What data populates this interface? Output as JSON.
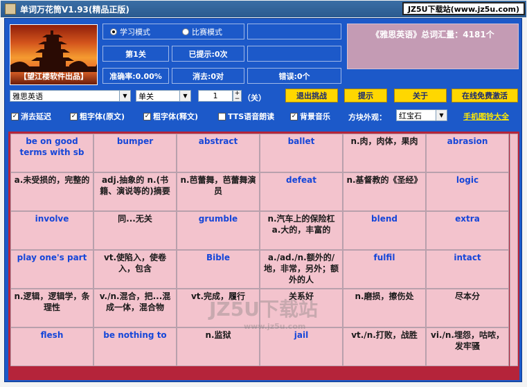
{
  "window": {
    "title": "单词万花筒V1.93(精品正版)",
    "badge": "JZ5U下载站(www.jz5u.com)"
  },
  "logo": {
    "caption": "【望江楼软件出品】"
  },
  "modes": {
    "study": "学习模式",
    "compete": "比赛模式",
    "selected": "study"
  },
  "stats": {
    "level": "第1关",
    "hints": "已提示:0次",
    "accuracy": "准确率:0.00%",
    "eliminated": "消去:0对",
    "errors": "错误:0个"
  },
  "vocab": {
    "text": "《雅思英语》总词汇量：4181个"
  },
  "controls": {
    "book": "雅思英语",
    "mode": "单关",
    "level_value": "1",
    "level_suffix": "（关）",
    "exit_button": "退出挑战",
    "hint_button": "提示",
    "about_button": "关于",
    "activate_button": "在线免费激活",
    "spin_up": "+",
    "spin_down": "−"
  },
  "options": {
    "delay": "消去延迟",
    "bold_orig": "粗字体(原文)",
    "bold_trans": "粗字体(释文)",
    "tts": "TTS语音朗读",
    "bgm": "背景音乐",
    "skin_label": "方块外观：",
    "skin_value": "红宝石",
    "ringtone_link": "手机图铃大全",
    "check_mark": "✓"
  },
  "grid": [
    [
      "be on good terms with sb",
      "bumper",
      "abstract",
      "ballet",
      "n.肉，肉体，果肉",
      "abrasion"
    ],
    [
      "a.未受损的，完整的",
      "adj.抽象的 n.(书籍、演说等的)摘要",
      "n.芭蕾舞，芭蕾舞演员",
      "defeat",
      "n.基督教的《圣经》",
      "logic"
    ],
    [
      "involve",
      "同...无关",
      "grumble",
      "n.汽车上的保险杠 a.大的，丰富的",
      "blend",
      "extra"
    ],
    [
      "play one's part",
      "vt.使陷入，使卷入，包含",
      "Bible",
      "a./ad./n.额外的/地，非常，另外；额外的人",
      "fulfil",
      "intact"
    ],
    [
      "n.逻辑，逻辑学，条理性",
      "v./n.混合，把...混成一体，混合物",
      "vt.完成，履行",
      "关系好",
      "n.磨损，擦伤处",
      "尽本分"
    ],
    [
      "flesh",
      "be nothing to",
      "n.监狱",
      "jail",
      "vt./n.打败，战胜",
      "vi./n.埋怨，咕哝，发牢骚"
    ]
  ],
  "watermark": {
    "main": "JZ5U下载站",
    "sub": "www.jz5u.com"
  }
}
